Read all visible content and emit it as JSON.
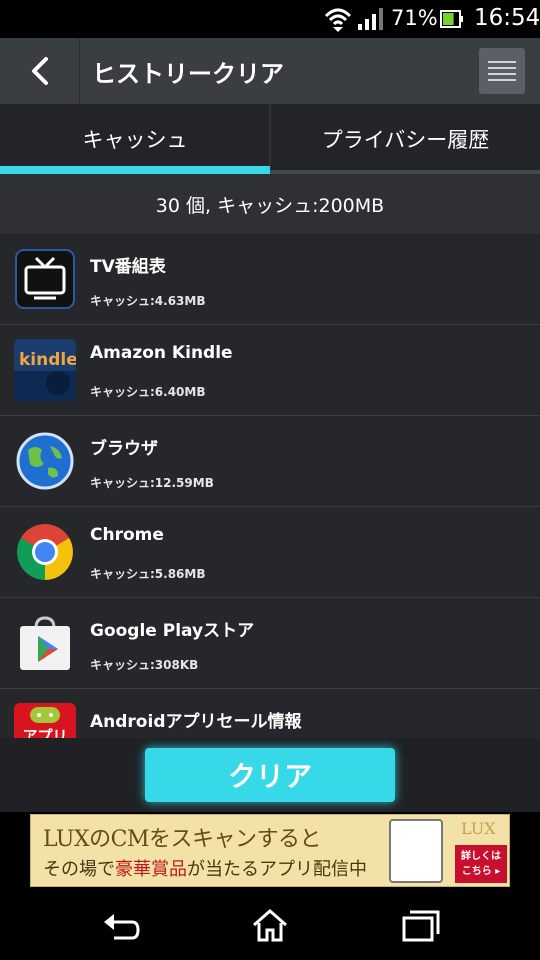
{
  "status": {
    "battery_percent": "71%",
    "time": "16:54",
    "battery_level": 0.71
  },
  "header": {
    "title": "ヒストリークリア"
  },
  "tabs": [
    {
      "label": "キャッシュ",
      "active": true
    },
    {
      "label": "プライバシー履歴",
      "active": false
    }
  ],
  "summary": "30 個, キャッシュ:200MB",
  "apps": [
    {
      "name": "TV番組表",
      "cache": "キャッシュ:4.63MB",
      "icon": "tv-guide-icon"
    },
    {
      "name": "Amazon Kindle",
      "cache": "キャッシュ:6.40MB",
      "icon": "kindle-icon",
      "icon_text": "kindle"
    },
    {
      "name": "ブラウザ",
      "cache": "キャッシュ:12.59MB",
      "icon": "globe-icon"
    },
    {
      "name": "Chrome",
      "cache": "キャッシュ:5.86MB",
      "icon": "chrome-icon"
    },
    {
      "name": "Google Playストア",
      "cache": "キャッシュ:308KB",
      "icon": "play-store-icon"
    },
    {
      "name": "Androidアプリセール情報",
      "cache": "",
      "icon": "android-sale-icon",
      "icon_text": "アプリ"
    }
  ],
  "actions": {
    "clear_label": "クリア"
  },
  "ad": {
    "line1": "LUXのCMをスキャンすると",
    "line2_prefix": "その場で",
    "line2_highlight": "豪華賞品",
    "line2_suffix": "が当たるアプリ配信中",
    "brand": "LUX",
    "detail_line1": "詳しくは",
    "detail_line2": "こちら ▸"
  },
  "colors": {
    "accent": "#38d9e6",
    "header_bg": "#3a3d42",
    "list_bg": "#25272b"
  }
}
